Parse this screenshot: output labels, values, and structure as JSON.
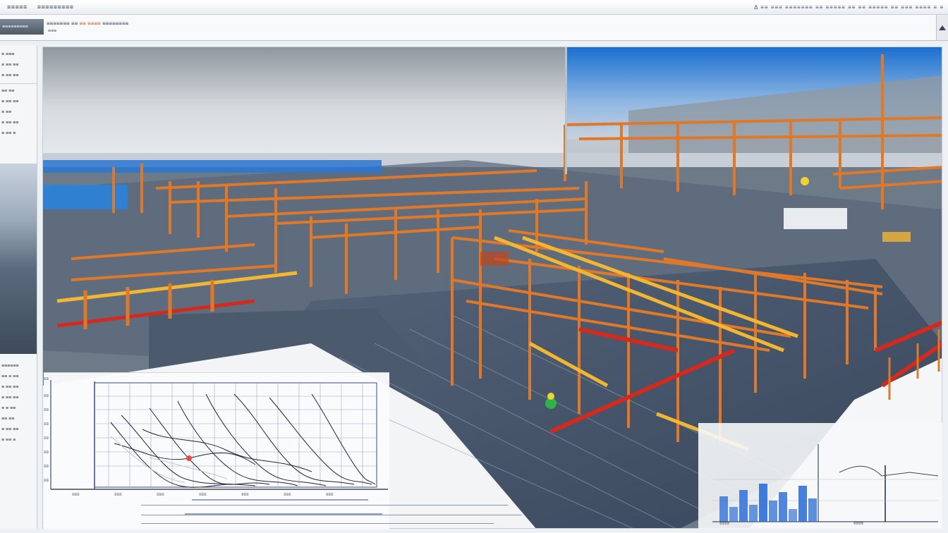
{
  "menubar": {
    "items": [
      "≡≡≡≡≡",
      "≡≡≡≡≡≡≡≡≡"
    ],
    "status": "Δ ≡≡ ≡≡≡ ≡≡≡≡≡≡≡ ≡≡ ≡≡≡≡≡ ≡≡ ≡≡ ≡≡≡≡≡ ≡≡ ≡≡≡ ≡≡≡≡ ≡ ≡"
  },
  "toolbar": {
    "brand": "≡≡≡≡≡≡≡≡≡",
    "file_prefix": "≡≡≡≡≡≡≡ ≡≡",
    "file_accent": "≡≡ ≡≡≡≡",
    "file_suffix": "≡≡≡≡≡≡≡≡",
    "file_sub": "≡≡≡"
  },
  "left_panel": {
    "top_rows": [
      "≡ ≡≡≡",
      "≡ ≡≡ ≡≡",
      "≡ ≡≡ ≡≡",
      "≡≡ ≡≡",
      "≡ ≡≡ ≡≡",
      "≡ ≡≡",
      "≡ ≡≡ ≡≡",
      "≡ ≡≡ ≡"
    ],
    "bottom_rows": [
      "≡≡≡≡≡≡",
      "≡≡ ≡ ≡≡",
      "≡ ≡≡ ≡≡",
      "≡ ≡≡ ≡≡",
      "≡ ≡ ≡≡",
      "≡≡ ≡≡",
      "≡ ≡≡ ≡≡",
      "≡ ≡≡ ≡"
    ]
  },
  "line_chart": {
    "y_ticks": [
      "≡≡",
      "≡≡",
      "≡≡",
      "≡≡",
      "≡≡",
      "≡≡",
      "≡≡",
      "≡≡"
    ],
    "x_ticks": [
      "≡≡≡",
      "≡≡≡",
      "≡≡≡",
      "≡≡≡",
      "≡≡≡",
      "≡≡≡",
      "≡≡≡"
    ]
  },
  "histogram": {
    "label_left": "≡≡≡≡",
    "label_right": "≡≡≡≡",
    "bar_values": [
      0.6,
      0.35,
      0.75,
      0.4,
      0.9,
      0.5,
      0.7,
      0.3,
      0.85,
      0.55
    ],
    "accent": "#2f6fd6"
  },
  "colors": {
    "steel_orange": "#e0782a",
    "steel_red": "#d42a1e",
    "steel_yellow": "#f2b632",
    "deck_blue": "#3d5a7a"
  }
}
